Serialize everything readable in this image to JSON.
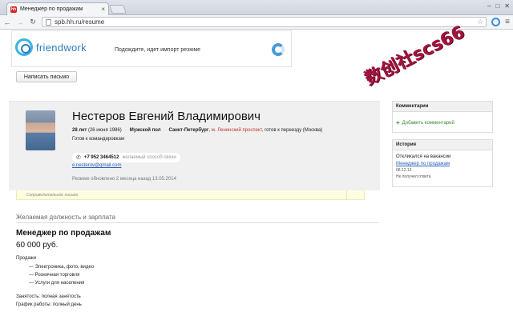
{
  "browser": {
    "tab_title": "Менеджер по продажам",
    "tab_favicon": "hh",
    "url": "spb.hh.ru/resume"
  },
  "friendwork": {
    "logo_text": "friendwork",
    "status": "Подождите, идет импорт резюме"
  },
  "actions": {
    "write_letter": "Написать письмо"
  },
  "watermark": "数创社scs66",
  "candidate": {
    "name": "Нестеров Евгений Владимирович",
    "age": "28 лет",
    "birthdate": "(26 июня 1986)",
    "gender": "Мужской пол",
    "city": "Санкт-Петербург",
    "metro": "м. Ленинский проспект",
    "relocation": ", готов к переезду (Москва)",
    "business_trips": "Готов к командировкам",
    "phone": "+7 952 3464512",
    "phone_pref": "желаемый способ связи",
    "email": "e.nesterov@gmail.com",
    "updated": "Резюме обновлено 2 месяца назад  13.05.2014"
  },
  "cover_letter": "Сопроводительное письмо",
  "sidebar": {
    "comments_title": "Комментарии",
    "add_comment": "Добавить комментарий",
    "history_title": "История",
    "responded_label": "Откликался на вакансии",
    "vacancy_link": "Менеджер по продажам",
    "vacancy_date": "08.12.13",
    "vacancy_status": "Не получил ответа"
  },
  "position": {
    "section_title": "Желаемая должность и зарплата",
    "title": "Менеджер по продажам",
    "salary": "60 000 руб.",
    "spec_head": "Продажи",
    "specs": [
      "— Электроника, фото, видео",
      "— Розничная торговля",
      "— Услуги для населения"
    ],
    "employment": "Занятость: полная занятость",
    "schedule": "График работы: полный день"
  }
}
